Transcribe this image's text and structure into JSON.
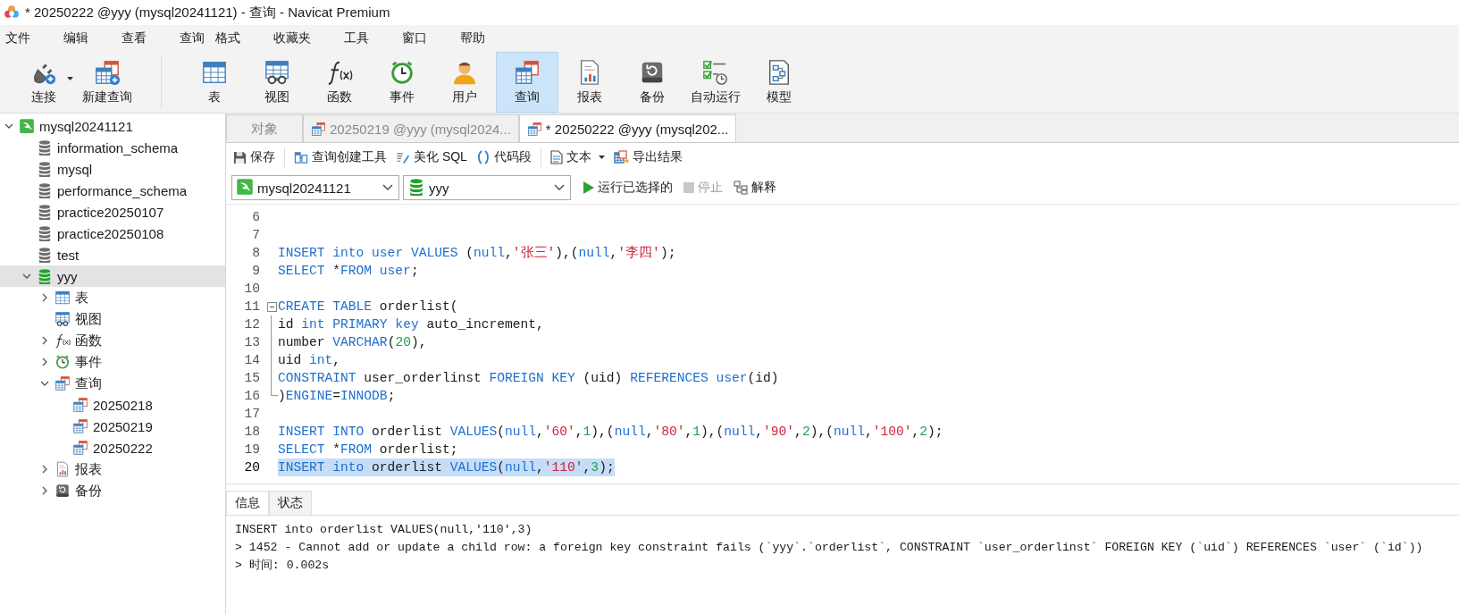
{
  "window": {
    "title": "* 20250222 @yyy (mysql20241121) - 查询 - Navicat Premium"
  },
  "menu": [
    "文件",
    "编辑",
    "查看",
    "查询",
    "格式",
    "收藏夹",
    "工具",
    "窗口",
    "帮助"
  ],
  "toolbar": [
    {
      "kind": "connect",
      "label": "连接",
      "selected": false,
      "dropdown": true
    },
    {
      "kind": "new-query",
      "label": "新建查询",
      "selected": false
    },
    {
      "kind": "table",
      "label": "表",
      "selected": false
    },
    {
      "kind": "view",
      "label": "视图",
      "selected": false
    },
    {
      "kind": "function",
      "label": "函数",
      "selected": false
    },
    {
      "kind": "event",
      "label": "事件",
      "selected": false
    },
    {
      "kind": "user",
      "label": "用户",
      "selected": false
    },
    {
      "kind": "query",
      "label": "查询",
      "selected": true
    },
    {
      "kind": "report",
      "label": "报表",
      "selected": false
    },
    {
      "kind": "backup",
      "label": "备份",
      "selected": false
    },
    {
      "kind": "automation",
      "label": "自动运行",
      "selected": false
    },
    {
      "kind": "model",
      "label": "模型",
      "selected": false
    }
  ],
  "sidebar": {
    "tree": [
      {
        "kind": "connection",
        "label": "mysql20241121",
        "expanded": true,
        "selected": false,
        "children": [
          {
            "kind": "database",
            "label": "information_schema",
            "open": false,
            "selected": false
          },
          {
            "kind": "database",
            "label": "mysql",
            "open": false,
            "selected": false
          },
          {
            "kind": "database",
            "label": "performance_schema",
            "open": false,
            "selected": false
          },
          {
            "kind": "database",
            "label": "practice20250107",
            "open": false,
            "selected": false
          },
          {
            "kind": "database",
            "label": "practice20250108",
            "open": false,
            "selected": false
          },
          {
            "kind": "database",
            "label": "test",
            "open": false,
            "selected": false
          },
          {
            "kind": "database",
            "label": "yyy",
            "open": true,
            "expanded": true,
            "selected": true,
            "children": [
              {
                "kind": "tables",
                "label": "表",
                "expanded": false,
                "selected": false
              },
              {
                "kind": "views",
                "label": "视图",
                "selected": false
              },
              {
                "kind": "functions",
                "label": "函数",
                "expanded": false,
                "selected": false
              },
              {
                "kind": "events",
                "label": "事件",
                "expanded": false,
                "selected": false
              },
              {
                "kind": "queries",
                "label": "查询",
                "expanded": true,
                "selected": false,
                "children": [
                  {
                    "kind": "query",
                    "label": "20250218",
                    "selected": false
                  },
                  {
                    "kind": "query",
                    "label": "20250219",
                    "selected": false
                  },
                  {
                    "kind": "query",
                    "label": "20250222",
                    "selected": false
                  }
                ]
              },
              {
                "kind": "reports",
                "label": "报表",
                "expanded": false,
                "selected": false
              },
              {
                "kind": "backups",
                "label": "备份",
                "expanded": false,
                "selected": false
              }
            ]
          }
        ]
      }
    ]
  },
  "tabs": [
    {
      "kind": "objects",
      "label": "对象",
      "selected": false
    },
    {
      "kind": "query",
      "label": "20250219 @yyy (mysql2024...",
      "selected": false
    },
    {
      "kind": "query",
      "label": "* 20250222 @yyy (mysql202...",
      "selected": true
    }
  ],
  "query_toolbar": [
    {
      "kind": "save",
      "label": "保存"
    },
    {
      "kind": "separator"
    },
    {
      "kind": "builder",
      "label": "查询创建工具"
    },
    {
      "kind": "beautify",
      "label": "美化 SQL"
    },
    {
      "kind": "snippet",
      "label": "代码段"
    },
    {
      "kind": "separator"
    },
    {
      "kind": "text",
      "label": "文本",
      "dropdown": true
    },
    {
      "kind": "export",
      "label": "导出结果"
    }
  ],
  "selectors": [
    {
      "kind": "connection",
      "value": "mysql20241121"
    },
    {
      "kind": "database",
      "value": "yyy"
    }
  ],
  "run_actions": [
    {
      "kind": "run",
      "label": "运行已选择的",
      "disabled": false
    },
    {
      "kind": "stop",
      "label": "停止",
      "disabled": true
    },
    {
      "kind": "explain",
      "label": "解释",
      "disabled": false
    }
  ],
  "editor": {
    "lines": [
      {
        "kind": "code",
        "number": "6",
        "selected": false
      },
      {
        "kind": "code",
        "number": "7",
        "selected": false
      },
      {
        "kind": "code",
        "number": "8",
        "selected": false,
        "tokens": [
          {
            "kind": "keyword",
            "text": "INSERT "
          },
          {
            "kind": "keyword",
            "text": "into "
          },
          {
            "kind": "keyword",
            "text": "user "
          },
          {
            "kind": "keyword",
            "text": "VALUES"
          },
          {
            "kind": "plain",
            "text": " ("
          },
          {
            "kind": "keyword",
            "text": "null"
          },
          {
            "kind": "plain",
            "text": ","
          },
          {
            "kind": "string",
            "text": "'张三'"
          },
          {
            "kind": "plain",
            "text": "),("
          },
          {
            "kind": "keyword",
            "text": "null"
          },
          {
            "kind": "plain",
            "text": ","
          },
          {
            "kind": "string",
            "text": "'李四'"
          },
          {
            "kind": "plain",
            "text": ");"
          }
        ]
      },
      {
        "kind": "code",
        "number": "9",
        "selected": false,
        "tokens": [
          {
            "kind": "keyword",
            "text": "SELECT"
          },
          {
            "kind": "plain",
            "text": " *"
          },
          {
            "kind": "keyword",
            "text": "FROM user"
          },
          {
            "kind": "plain",
            "text": ";"
          }
        ]
      },
      {
        "kind": "code",
        "number": "10",
        "selected": false
      },
      {
        "kind": "fold-start",
        "number": "11",
        "selected": false,
        "tokens": [
          {
            "kind": "keyword",
            "text": "CREATE TABLE"
          },
          {
            "kind": "plain",
            "text": " orderlist("
          }
        ]
      },
      {
        "kind": "fold-body",
        "number": "12",
        "selected": false,
        "tokens": [
          {
            "kind": "plain",
            "text": "id "
          },
          {
            "kind": "keyword",
            "text": "int PRIMARY key"
          },
          {
            "kind": "plain",
            "text": " auto_increment,"
          }
        ]
      },
      {
        "kind": "fold-body",
        "number": "13",
        "selected": false,
        "tokens": [
          {
            "kind": "plain",
            "text": "number "
          },
          {
            "kind": "keyword",
            "text": "VARCHAR"
          },
          {
            "kind": "plain",
            "text": "("
          },
          {
            "kind": "number",
            "text": "20"
          },
          {
            "kind": "plain",
            "text": "),"
          }
        ]
      },
      {
        "kind": "fold-body",
        "number": "14",
        "selected": false,
        "tokens": [
          {
            "kind": "plain",
            "text": "uid "
          },
          {
            "kind": "keyword",
            "text": "int"
          },
          {
            "kind": "plain",
            "text": ","
          }
        ]
      },
      {
        "kind": "fold-body",
        "number": "15",
        "selected": false,
        "tokens": [
          {
            "kind": "keyword",
            "text": "CONSTRAINT"
          },
          {
            "kind": "plain",
            "text": " user_orderlinst "
          },
          {
            "kind": "keyword",
            "text": "FOREIGN KEY"
          },
          {
            "kind": "plain",
            "text": " (uid) "
          },
          {
            "kind": "keyword",
            "text": "REFERENCES user"
          },
          {
            "kind": "plain",
            "text": "(id)"
          }
        ]
      },
      {
        "kind": "fold-end",
        "number": "16",
        "selected": false,
        "tokens": [
          {
            "kind": "plain",
            "text": ")"
          },
          {
            "kind": "keyword",
            "text": "ENGINE"
          },
          {
            "kind": "plain",
            "text": "="
          },
          {
            "kind": "keyword",
            "text": "INNODB"
          },
          {
            "kind": "plain",
            "text": ";"
          }
        ]
      },
      {
        "kind": "code",
        "number": "17",
        "selected": false
      },
      {
        "kind": "code",
        "number": "18",
        "selected": false,
        "tokens": [
          {
            "kind": "keyword",
            "text": "INSERT INTO"
          },
          {
            "kind": "plain",
            "text": " orderlist "
          },
          {
            "kind": "keyword",
            "text": "VALUES"
          },
          {
            "kind": "plain",
            "text": "("
          },
          {
            "kind": "keyword",
            "text": "null"
          },
          {
            "kind": "plain",
            "text": ","
          },
          {
            "kind": "string",
            "text": "'60'"
          },
          {
            "kind": "plain",
            "text": ","
          },
          {
            "kind": "number",
            "text": "1"
          },
          {
            "kind": "plain",
            "text": "),("
          },
          {
            "kind": "keyword",
            "text": "null"
          },
          {
            "kind": "plain",
            "text": ","
          },
          {
            "kind": "string",
            "text": "'80'"
          },
          {
            "kind": "plain",
            "text": ","
          },
          {
            "kind": "number",
            "text": "1"
          },
          {
            "kind": "plain",
            "text": "),("
          },
          {
            "kind": "keyword",
            "text": "null"
          },
          {
            "kind": "plain",
            "text": ","
          },
          {
            "kind": "string",
            "text": "'90'"
          },
          {
            "kind": "plain",
            "text": ","
          },
          {
            "kind": "number",
            "text": "2"
          },
          {
            "kind": "plain",
            "text": "),("
          },
          {
            "kind": "keyword",
            "text": "null"
          },
          {
            "kind": "plain",
            "text": ","
          },
          {
            "kind": "string",
            "text": "'100'"
          },
          {
            "kind": "plain",
            "text": ","
          },
          {
            "kind": "number",
            "text": "2"
          },
          {
            "kind": "plain",
            "text": ");"
          }
        ]
      },
      {
        "kind": "code",
        "number": "19",
        "selected": false,
        "tokens": [
          {
            "kind": "keyword",
            "text": "SELECT"
          },
          {
            "kind": "plain",
            "text": " *"
          },
          {
            "kind": "keyword",
            "text": "FROM"
          },
          {
            "kind": "plain",
            "text": " orderlist;"
          }
        ]
      },
      {
        "kind": "code",
        "number": "20",
        "selected": true,
        "tokens": [
          {
            "kind": "keyword",
            "text": "INSERT into"
          },
          {
            "kind": "plain",
            "text": " orderlist "
          },
          {
            "kind": "keyword",
            "text": "VALUES"
          },
          {
            "kind": "plain",
            "text": "("
          },
          {
            "kind": "keyword",
            "text": "null"
          },
          {
            "kind": "plain",
            "text": ","
          },
          {
            "kind": "string",
            "text": "'110'"
          },
          {
            "kind": "plain",
            "text": ","
          },
          {
            "kind": "number",
            "text": "3"
          },
          {
            "kind": "plain",
            "text": ");"
          }
        ]
      }
    ]
  },
  "result_tabs": [
    {
      "label": "信息",
      "selected": true
    },
    {
      "label": "状态",
      "selected": false
    }
  ],
  "messages": [
    "INSERT into orderlist VALUES(null,'110',3)",
    "> 1452 - Cannot add or update a child row: a foreign key constraint fails (`yyy`.`orderlist`, CONSTRAINT `user_orderlinst` FOREIGN KEY (`uid`) REFERENCES `user` (`id`))",
    "> 时间: 0.002s"
  ]
}
